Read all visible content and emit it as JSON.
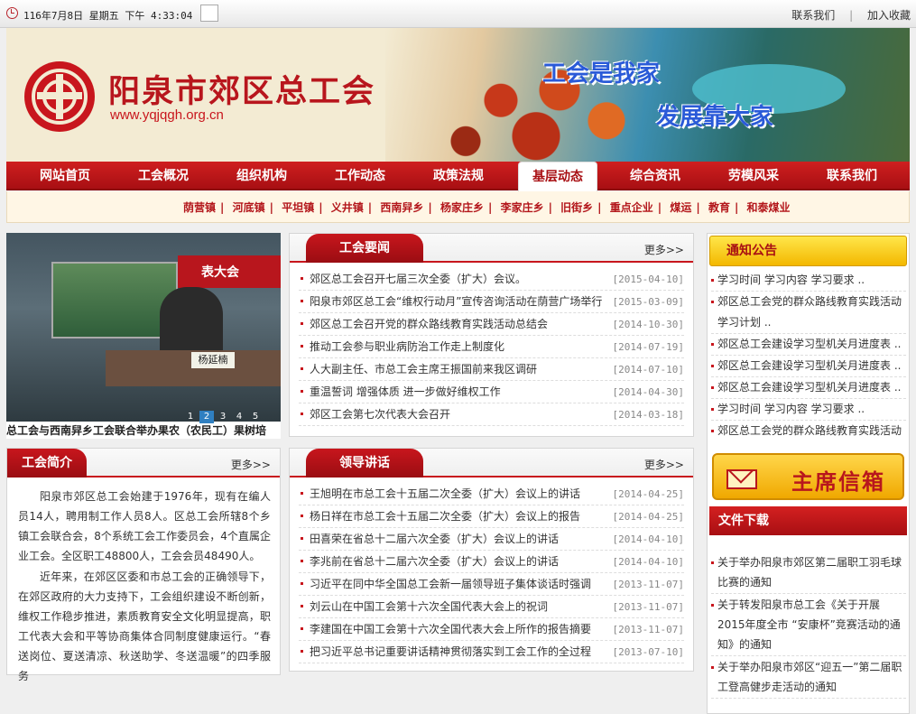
{
  "topbar": {
    "datetime": "116年7月8日 星期五 下午 4:33:04",
    "contact_label": "联系我们",
    "favorite_label": "加入收藏",
    "divider": "|"
  },
  "header": {
    "site_name": "阳泉市郊区总工会",
    "site_url": "www.yqjqgh.org.cn",
    "slogan_1": "工会是我家",
    "slogan_2": "发展靠大家"
  },
  "nav": {
    "items": [
      {
        "label": "网站首页"
      },
      {
        "label": "工会概况"
      },
      {
        "label": "组织机构"
      },
      {
        "label": "工作动态"
      },
      {
        "label": "政策法规"
      },
      {
        "label": "基层动态"
      },
      {
        "label": "综合资讯"
      },
      {
        "label": "劳模风采"
      },
      {
        "label": "联系我们"
      }
    ],
    "active": "基层动态"
  },
  "subnav": {
    "items": [
      "荫营镇",
      "河底镇",
      "平坦镇",
      "义井镇",
      "西南舁乡",
      "杨家庄乡",
      "李家庄乡",
      "旧街乡",
      "重点企业",
      "煤运",
      "教育",
      "和泰煤业"
    ],
    "separator": "|"
  },
  "slideshow": {
    "screen_banner": "表大会",
    "nameplate": "杨延楠",
    "pages": [
      "1",
      "2",
      "3",
      "4",
      "5"
    ],
    "active_page": "2",
    "caption": "总工会与西南舁乡工会联合举办果农（农民工）果树培"
  },
  "news": {
    "title": "工会要闻",
    "more": "更多>>",
    "items": [
      {
        "title": "郊区总工会召开七届三次全委（扩大）会议。",
        "date": "[2015-04-10]"
      },
      {
        "title": "阳泉市郊区总工会“维权行动月”宣传咨询活动在荫营广场举行",
        "date": "[2015-03-09]"
      },
      {
        "title": "郊区总工会召开党的群众路线教育实践活动总结会",
        "date": "[2014-10-30]"
      },
      {
        "title": "推动工会参与职业病防治工作走上制度化",
        "date": "[2014-07-19]"
      },
      {
        "title": "人大副主任、市总工会主席王振国前来我区调研",
        "date": "[2014-07-10]"
      },
      {
        "title": "重温誓词 增强体质 进一步做好维权工作",
        "date": "[2014-04-30]"
      },
      {
        "title": "郊区工会第七次代表大会召开",
        "date": "[2014-03-18]"
      }
    ]
  },
  "intro": {
    "title": "工会简介",
    "more": "更多>>",
    "paragraph_1": "阳泉市郊区总工会始建于1976年，现有在编人员14人，聘用制工作人员8人。区总工会所辖8个乡镇工会联合会，8个系统工会工作委员会，4个直属企业工会。全区职工48800人，工会会员48490人。",
    "paragraph_2": "近年来，在郊区区委和市总工会的正确领导下，在郊区政府的大力支持下，工会组织建设不断创新，维权工作稳步推进，素质教育安全文化明显提高，职工代表大会和平等协商集体合同制度健康运行。“春送岗位、夏送清凉、秋送助学、冬送温暖”的四季服务"
  },
  "speeches": {
    "title": "领导讲话",
    "more": "更多>>",
    "items": [
      {
        "title": "王旭明在市总工会十五届二次全委（扩大）会议上的讲话",
        "date": "[2014-04-25]"
      },
      {
        "title": "杨日祥在市总工会十五届二次全委（扩大）会议上的报告",
        "date": "[2014-04-25]"
      },
      {
        "title": "田喜荣在省总十二届六次全委（扩大）会议上的讲话",
        "date": "[2014-04-10]"
      },
      {
        "title": "李兆前在省总十二届六次全委（扩大）会议上的讲话",
        "date": "[2014-04-10]"
      },
      {
        "title": "习近平在同中华全国总工会新一届领导班子集体谈话时强调",
        "date": "[2013-11-07]"
      },
      {
        "title": "刘云山在中国工会第十六次全国代表大会上的祝词",
        "date": "[2013-11-07]"
      },
      {
        "title": "李建国在中国工会第十六次全国代表大会上所作的报告摘要",
        "date": "[2013-11-07]"
      },
      {
        "title": "把习近平总书记重要讲话精神贯彻落实到工会工作的全过程",
        "date": "[2013-07-10]"
      }
    ]
  },
  "notices": {
    "title": "通知公告",
    "items": [
      "学习时间 学习内容 学习要求 ..",
      "郊区总工会党的群众路线教育实践活动学习计划 ..",
      "郊区总工会建设学习型机关月进度表 ..",
      "郊区总工会建设学习型机关月进度表 ..",
      "郊区总工会建设学习型机关月进度表 ..",
      "学习时间 学习内容 学习要求 ..",
      "郊区总工会党的群众路线教育实践活动学习计划 .."
    ]
  },
  "mailbox": {
    "label": "主席信箱"
  },
  "downloads": {
    "title": "文件下载",
    "items": [
      "关于举办阳泉市郊区第二届职工羽毛球比赛的通知",
      "关于转发阳泉市总工会《关于开展2015年度全市 “安康杯”竞赛活动的通知》的通知",
      "关于举办阳泉市郊区“迎五一”第二届职工登高健步走活动的通知"
    ]
  },
  "colors": {
    "brand_red": "#c8161d",
    "nav_red": "#a80f13",
    "notice_yellow": "#f3b800",
    "slogan_blue": "#2a5ad8"
  }
}
